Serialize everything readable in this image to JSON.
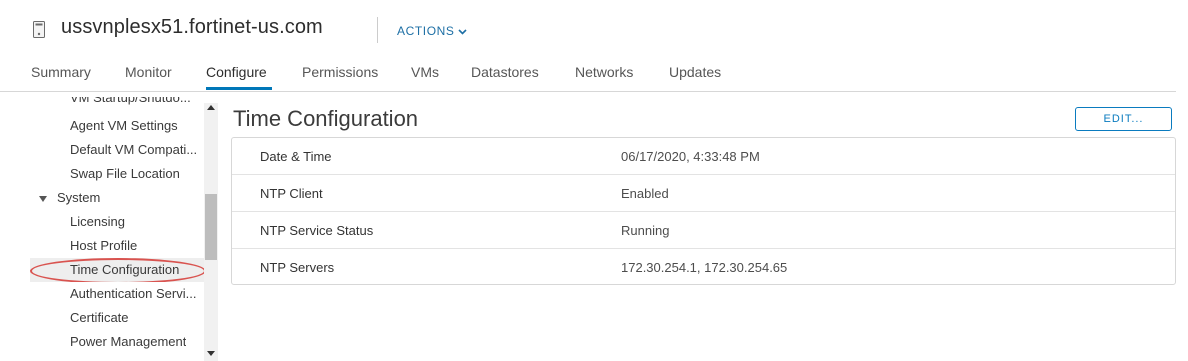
{
  "header": {
    "host_name": "ussvnplesx51.fortinet-us.com",
    "actions_label": "ACTIONS",
    "actions_chevron": "⌄"
  },
  "tabs": [
    {
      "label": "Summary"
    },
    {
      "label": "Monitor"
    },
    {
      "label": "Configure",
      "active": true
    },
    {
      "label": "Permissions"
    },
    {
      "label": "VMs"
    },
    {
      "label": "Datastores"
    },
    {
      "label": "Networks"
    },
    {
      "label": "Updates"
    }
  ],
  "sidebar": {
    "items": [
      {
        "label": "VM Startup/Shutdo..."
      },
      {
        "label": "Agent VM Settings"
      },
      {
        "label": "Default VM Compati..."
      },
      {
        "label": "Swap File Location"
      },
      {
        "label": "System",
        "expanded": true
      },
      {
        "label": "Licensing"
      },
      {
        "label": "Host Profile"
      },
      {
        "label": "Time Configuration",
        "selected": true
      },
      {
        "label": "Authentication Servi..."
      },
      {
        "label": "Certificate"
      },
      {
        "label": "Power Management"
      }
    ]
  },
  "content": {
    "title": "Time Configuration",
    "edit_label": "EDIT...",
    "rows": [
      {
        "key": "Date & Time",
        "value": "06/17/2020, 4:33:48 PM"
      },
      {
        "key": "NTP Client",
        "value": "Enabled"
      },
      {
        "key": "NTP Service Status",
        "value": "Running"
      },
      {
        "key": "NTP Servers",
        "value": "172.30.254.1, 172.30.254.65"
      }
    ]
  },
  "colors": {
    "accent": "#0077b8",
    "highlight_oval": "#d9534f"
  },
  "icons": {
    "host": "host-server-icon",
    "expand": "triangle-down-icon",
    "scroll_up": "scroll-up-arrow-icon",
    "scroll_down": "scroll-down-arrow-icon"
  }
}
